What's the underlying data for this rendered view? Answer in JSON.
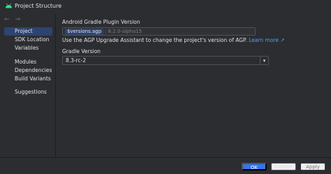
{
  "window": {
    "title": "Project Structure"
  },
  "nav": {
    "back": "←",
    "forward": "→"
  },
  "sidebar": {
    "items": [
      {
        "label": "Project",
        "selected": true
      },
      {
        "label": "SDK Location"
      },
      {
        "label": "Variables"
      },
      {
        "label": "Modules"
      },
      {
        "label": "Dependencies"
      },
      {
        "label": "Build Variants"
      },
      {
        "label": "Suggestions"
      }
    ]
  },
  "agp": {
    "label": "Android Gradle Plugin Version",
    "chip": "$versions.agp",
    "resolved": ": 8.2.0-alpha15",
    "hint": "Use the AGP Upgrade Assistant to change the project's version of AGP.",
    "learn_more": "Learn more ↗"
  },
  "gradle": {
    "label": "Gradle Version",
    "value": "8.3-rc-2",
    "dropdown_icon": "▾"
  },
  "footer": {
    "ok": "OK",
    "cancel": "Cancel",
    "apply": "Apply"
  },
  "colors": {
    "accent": "#3574f0",
    "selection": "#2e436e",
    "link": "#589df6",
    "android": "#3ddc84"
  }
}
